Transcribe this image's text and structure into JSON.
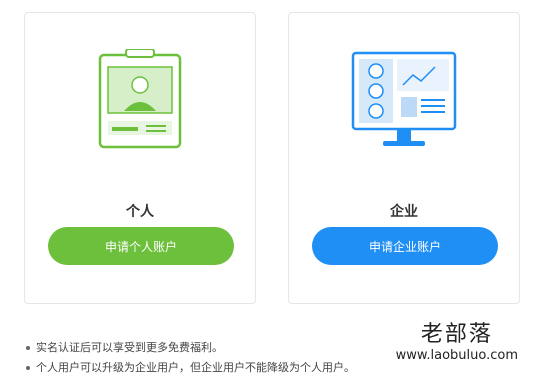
{
  "cards": [
    {
      "title": "个人",
      "button_label": "申请个人账户",
      "accent": "#6cc03c"
    },
    {
      "title": "企业",
      "button_label": "申请企业账户",
      "accent": "#1f8ef5"
    }
  ],
  "notes": [
    "实名认证后可以享受到更多免费福利。",
    "个人用户可以升级为企业用户，但企业用户不能降级为个人用户。"
  ],
  "watermark": {
    "name": "老部落",
    "url": "www.laobuluo.com"
  },
  "icons": {
    "personal": "id-badge-icon",
    "enterprise": "monitor-dashboard-icon"
  }
}
